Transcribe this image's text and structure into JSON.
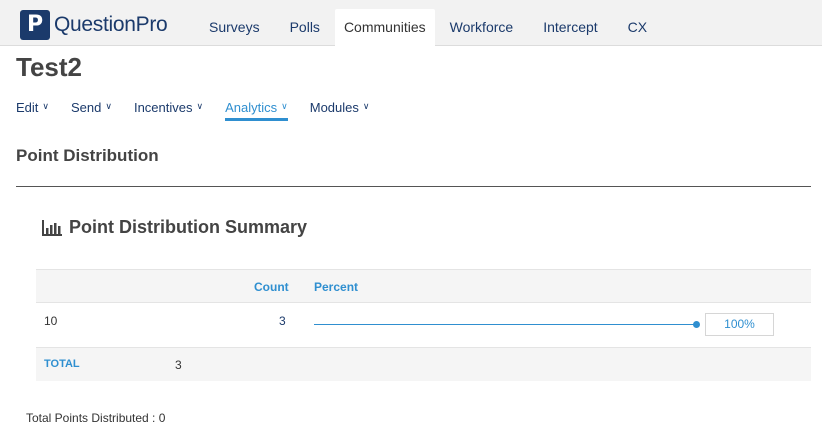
{
  "brand": {
    "logo_letter": "P",
    "name": "QuestionPro",
    "color": "#1b3a6b"
  },
  "topnav": {
    "tabs": [
      {
        "label": "Surveys"
      },
      {
        "label": "Polls"
      },
      {
        "label": "Communities",
        "active": true
      },
      {
        "label": "Workforce"
      },
      {
        "label": "Intercept"
      },
      {
        "label": "CX"
      }
    ]
  },
  "page": {
    "title": "Test2"
  },
  "subnav": {
    "items": [
      {
        "label": "Edit"
      },
      {
        "label": "Send"
      },
      {
        "label": "Incentives"
      },
      {
        "label": "Analytics",
        "active": true
      },
      {
        "label": "Modules"
      }
    ]
  },
  "section": {
    "title": "Point Distribution"
  },
  "summary": {
    "title": "Point Distribution Summary",
    "icon": "bar-chart-icon",
    "columns": {
      "count": "Count",
      "percent": "Percent"
    },
    "rows": [
      {
        "label": "10",
        "count": "3",
        "percent_label": "100%",
        "percent_value": 100
      }
    ],
    "total": {
      "label": "TOTAL",
      "value": "3"
    }
  },
  "footer": {
    "note": "Total Points Distributed : 0"
  },
  "colors": {
    "accent": "#2f8fd0",
    "nav_text": "#1b3a6b"
  }
}
